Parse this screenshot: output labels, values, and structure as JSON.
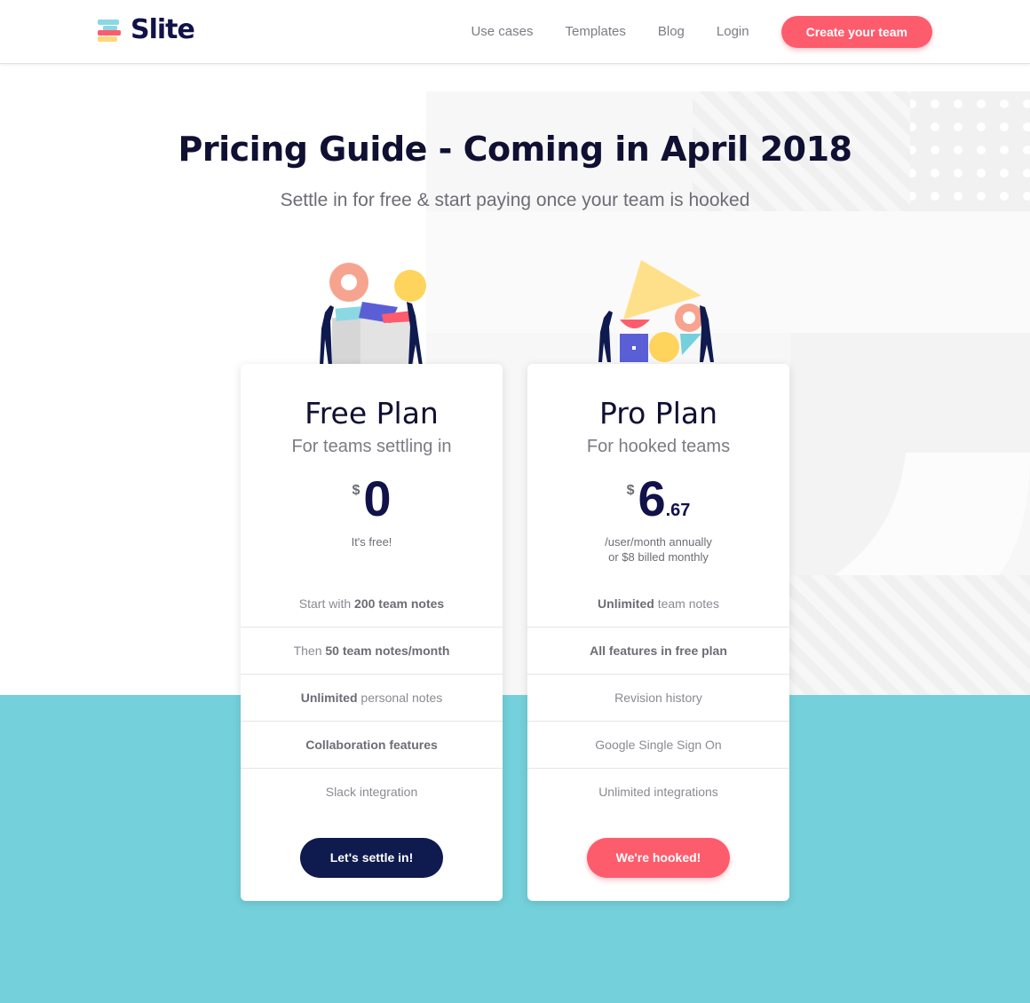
{
  "header": {
    "logo_text": "Slite",
    "nav": [
      "Use cases",
      "Templates",
      "Blog",
      "Login"
    ],
    "cta_label": "Create your team"
  },
  "hero": {
    "title": "Pricing Guide - Coming in April 2018",
    "subtitle": "Settle in for free & start paying once your team is hooked"
  },
  "plans": [
    {
      "name": "Free Plan",
      "tagline": "For teams settling in",
      "currency": "$",
      "amount": "0",
      "decimals": "",
      "note_line1": "It's free!",
      "note_line2": "",
      "features": [
        {
          "pre": "Start with ",
          "bold": "200 team notes",
          "post": ""
        },
        {
          "pre": "Then ",
          "bold": "50 team notes/month",
          "post": ""
        },
        {
          "pre": "",
          "bold": "Unlimited",
          "post": " personal notes"
        },
        {
          "pre": "",
          "bold": "Collaboration features",
          "post": ""
        },
        {
          "pre": "Slack integration",
          "bold": "",
          "post": ""
        }
      ],
      "button_label": "Let's settle in!"
    },
    {
      "name": "Pro Plan",
      "tagline": "For hooked teams",
      "currency": "$",
      "amount": "6",
      "decimals": ".67",
      "note_line1": "/user/month annually",
      "note_line2": "or $8 billed monthly",
      "features": [
        {
          "pre": "",
          "bold": "Unlimited",
          "post": " team notes"
        },
        {
          "pre": "",
          "bold": "All features in free plan",
          "post": ""
        },
        {
          "pre": "Revision history",
          "bold": "",
          "post": ""
        },
        {
          "pre": "Google Single Sign On",
          "bold": "",
          "post": ""
        },
        {
          "pre": "Unlimited integrations",
          "bold": "",
          "post": ""
        }
      ],
      "button_label": "We're hooked!"
    }
  ],
  "colors": {
    "brand_dark": "#11124a",
    "accent_pink": "#fd5c6d",
    "teal": "#74d0da",
    "button_dark": "#0f1a4e"
  }
}
